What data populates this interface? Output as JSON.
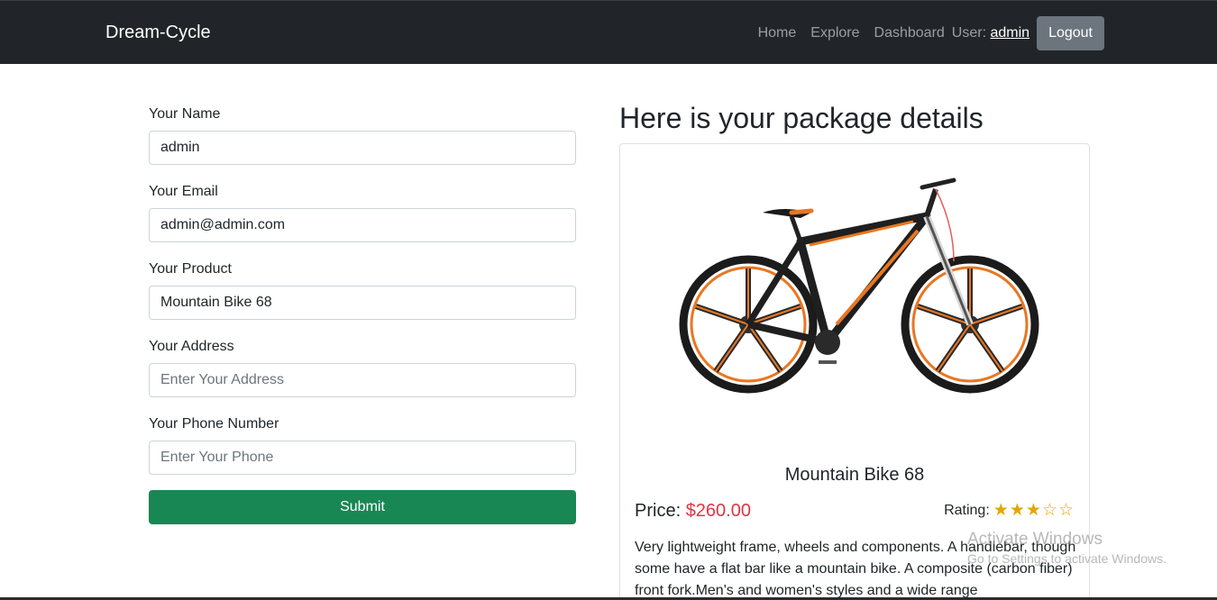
{
  "navbar": {
    "brand": "Dream-Cycle",
    "links": [
      "Home",
      "Explore",
      "Dashboard"
    ],
    "user_prefix": "User:",
    "user_name": "admin",
    "logout_label": "Logout"
  },
  "form": {
    "name_label": "Your Name",
    "name_value": "admin",
    "email_label": "Your Email",
    "email_value": "admin@admin.com",
    "product_label": "Your Product",
    "product_value": "Mountain Bike 68",
    "address_label": "Your Address",
    "address_placeholder": "Enter Your Address",
    "phone_label": "Your Phone Number",
    "phone_placeholder": "Enter Your Phone",
    "submit_label": "Submit"
  },
  "details": {
    "heading": "Here is your package details",
    "product_name": "Mountain Bike 68",
    "price_label": "Price:",
    "price_value": "$260.00",
    "rating_label": "Rating:",
    "rating_value": 3,
    "rating_max": 5,
    "description": "Very lightweight frame, wheels and components. A handlebar, though some have a flat bar like a mountain bike. A composite (carbon fiber) front fork.Men's and women's styles and a wide range"
  },
  "watermark": {
    "line1": "Activate Windows",
    "line2": "Go to Settings to activate Windows."
  },
  "colors": {
    "navbar_bg": "#212529",
    "submit_bg": "#198754",
    "price": "#dc3545",
    "star": "#e0a800"
  }
}
